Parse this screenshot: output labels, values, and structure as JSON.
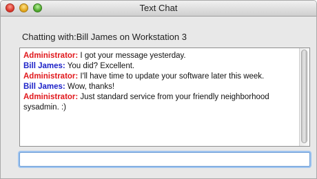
{
  "window": {
    "title": "Text Chat"
  },
  "chatting": {
    "label": "Chatting with:",
    "peer": "Bill James on Workstation 3"
  },
  "messages": [
    {
      "sender": "Administrator:",
      "text": " I got your message yesterday.",
      "color": "#e0171b"
    },
    {
      "sender": "Bill James:",
      "text": " You did? Excellent.",
      "color": "#1d22c8"
    },
    {
      "sender": "Administrator:",
      "text": " I'll have time to update your software later this week.",
      "color": "#e0171b"
    },
    {
      "sender": "Bill James:",
      "text": " Wow, thanks!",
      "color": "#1d22c8"
    },
    {
      "sender": "Administrator:",
      "text": " Just standard service from your friendly neighborhood sysadmin. :)",
      "color": "#e0171b"
    }
  ],
  "input": {
    "value": "",
    "placeholder": ""
  }
}
